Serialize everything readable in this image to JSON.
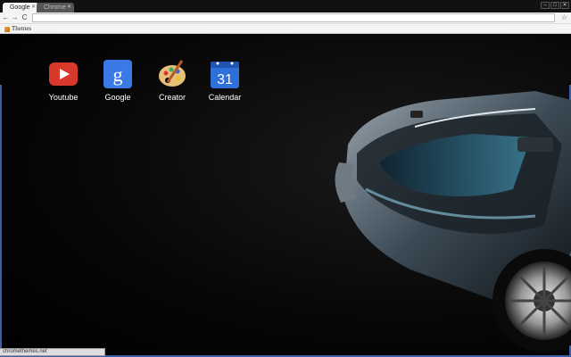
{
  "tabs": [
    {
      "title": "Google",
      "active": true
    },
    {
      "title": "Chrome",
      "active": false
    }
  ],
  "toolbar": {
    "back": "←",
    "forward": "→",
    "reload": "C",
    "bookmark_star": "☆",
    "address": ""
  },
  "bookmarks": [
    {
      "label": "Themes"
    }
  ],
  "apps": [
    {
      "label": "Youtube"
    },
    {
      "label": "Google"
    },
    {
      "label": "Creator"
    },
    {
      "label": "Calendar",
      "day": "31"
    }
  ],
  "status_bar": {
    "text": "chromethemes.net"
  },
  "colors": {
    "accent_blue": "#3a5ea8",
    "youtube_red": "#d9382c",
    "google_blue": "#3b7ae6",
    "calendar_blue": "#2f6fd8"
  }
}
